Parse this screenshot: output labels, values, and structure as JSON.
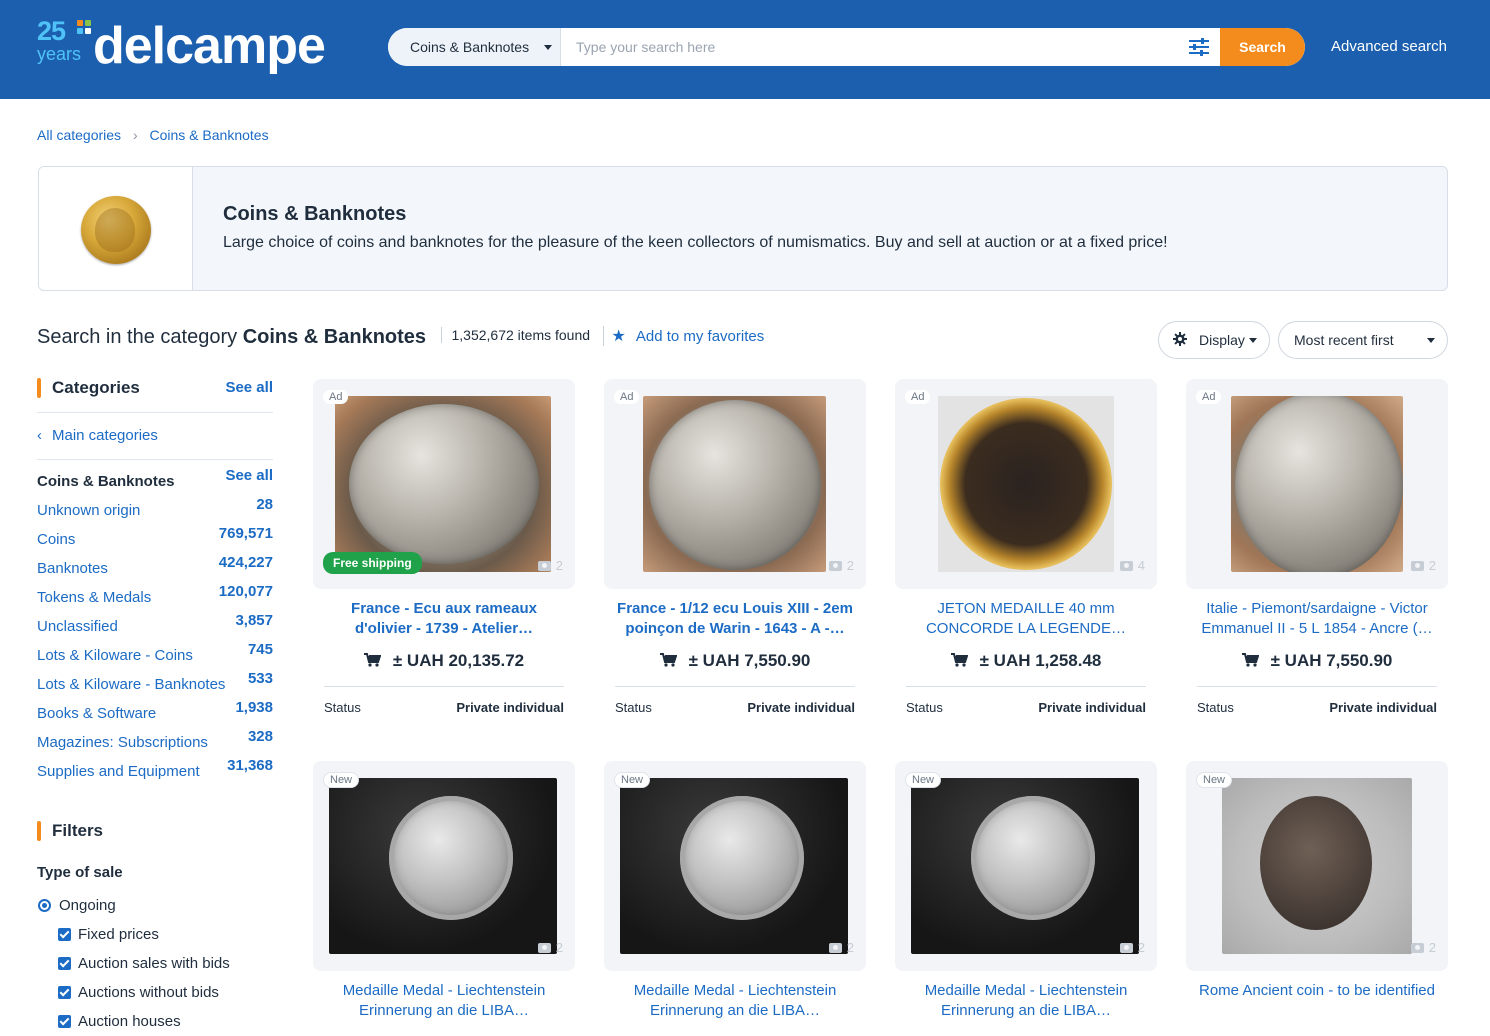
{
  "header": {
    "logo_years_num": "25",
    "logo_years_text": "years",
    "logo_brand": "delcampe",
    "search_category": "Coins & Banknotes",
    "search_placeholder": "Type your search here",
    "search_button": "Search",
    "advanced_search": "Advanced search",
    "colors": {
      "header_bg": "#1c5fae",
      "accent": "#f38b1d"
    }
  },
  "breadcrumb": {
    "items": [
      "All categories",
      "Coins & Banknotes"
    ]
  },
  "banner": {
    "title": "Coins & Banknotes",
    "description": "Large choice of coins and banknotes for the pleasure of the keen collectors of numismatics. Buy and sell at auction or at a fixed price!"
  },
  "summary": {
    "lead": "Search in the category ",
    "category": "Coins & Banknotes",
    "count": "1,352,672 items found",
    "favorite": "Add to my favorites"
  },
  "toolbar": {
    "display_label": "Display",
    "sort_label": "Most recent first"
  },
  "sidebar": {
    "categories_title": "Categories",
    "categories_see_all": "See all",
    "main_categories": "Main categories",
    "current": {
      "label": "Coins & Banknotes",
      "see_all": "See all"
    },
    "items": [
      {
        "label": "Unknown origin",
        "count": "28"
      },
      {
        "label": "Coins",
        "count": "769,571"
      },
      {
        "label": "Banknotes",
        "count": "424,227"
      },
      {
        "label": "Tokens & Medals",
        "count": "120,077"
      },
      {
        "label": "Unclassified",
        "count": "3,857"
      },
      {
        "label": "Lots & Kiloware - Coins",
        "count": "745"
      },
      {
        "label": "Lots & Kiloware - Banknotes",
        "count": "533"
      },
      {
        "label": "Books & Software",
        "count": "1,938"
      },
      {
        "label": "Magazines: Subscriptions",
        "count": "328"
      },
      {
        "label": "Supplies and Equipment",
        "count": "31,368"
      }
    ],
    "filters_title": "Filters",
    "type_of_sale": "Type of sale",
    "ongoing": "Ongoing",
    "checks": [
      "Fixed prices",
      "Auction sales with bids",
      "Auctions without bids",
      "Auction houses"
    ]
  },
  "items": [
    {
      "badge": "Ad",
      "free_shipping": "Free shipping",
      "photos": "2",
      "title": "France - Ecu aux rameaux d'olivier - 1739 - Atelier…",
      "bold": true,
      "price": "± UAH 20,135.72",
      "status_label": "Status",
      "seller": "Private individual"
    },
    {
      "badge": "Ad",
      "photos": "2",
      "title": "France - 1/12 ecu Louis XIII - 2em poinçon de Warin - 1643 - A -…",
      "bold": true,
      "price": "± UAH 7,550.90",
      "status_label": "Status",
      "seller": "Private individual"
    },
    {
      "badge": "Ad",
      "photos": "4",
      "title": "JETON MEDAILLE 40 mm CONCORDE LA LEGENDE…",
      "bold": false,
      "price": "± UAH 1,258.48",
      "status_label": "Status",
      "seller": "Private individual"
    },
    {
      "badge": "Ad",
      "photos": "2",
      "title": "Italie - Piemont/sardaigne - Victor Emmanuel II - 5 L 1854 - Ancre (…",
      "bold": false,
      "price": "± UAH 7,550.90",
      "status_label": "Status",
      "seller": "Private individual"
    },
    {
      "badge": "New",
      "photos": "2",
      "title": "Medaille Medal - Liechtenstein Erinnerung an die LIBA…",
      "bold": false
    },
    {
      "badge": "New",
      "photos": "2",
      "title": "Medaille Medal - Liechtenstein Erinnerung an die LIBA…",
      "bold": false
    },
    {
      "badge": "New",
      "photos": "2",
      "title": "Medaille Medal - Liechtenstein Erinnerung an die LIBA…",
      "bold": false
    },
    {
      "badge": "New",
      "photos": "2",
      "title": "Rome Ancient coin - to be identified",
      "bold": false
    }
  ]
}
